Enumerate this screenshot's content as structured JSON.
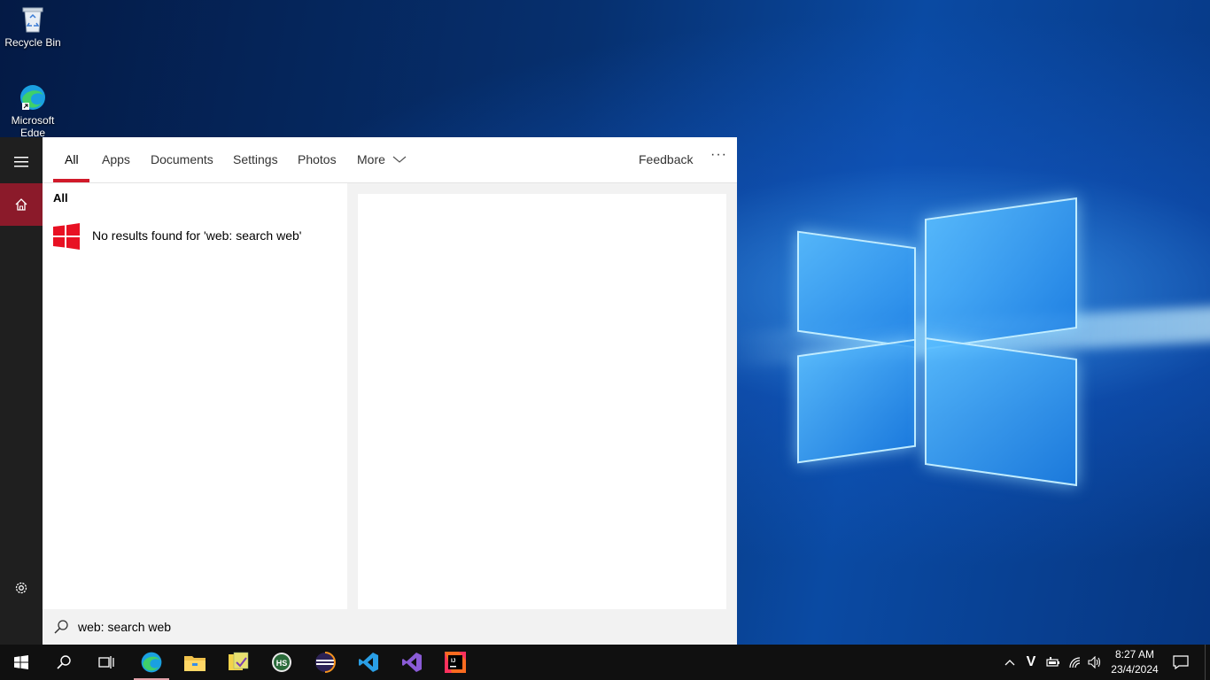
{
  "desktop": {
    "icons": [
      {
        "label": "Recycle Bin",
        "icon": "recycle-bin-icon"
      },
      {
        "label": "Microsoft Edge",
        "icon": "edge-icon"
      }
    ]
  },
  "search_panel": {
    "tabs": [
      {
        "label": "All",
        "active": true
      },
      {
        "label": "Apps"
      },
      {
        "label": "Documents"
      },
      {
        "label": "Settings"
      },
      {
        "label": "Photos"
      },
      {
        "label": "More"
      }
    ],
    "feedback_label": "Feedback",
    "more_options_glyph": "···",
    "section_header": "All",
    "no_results_text": "No results found for 'web: search web'",
    "query": "web: search web"
  },
  "taskbar": {
    "apps": [
      "start-icon",
      "search-icon",
      "task-view-icon",
      "edge-icon",
      "file-explorer-icon",
      "sticky-app-icon",
      "hs-app-icon",
      "eclipse-icon",
      "vscode-icon",
      "visual-studio-icon",
      "intellij-icon"
    ],
    "tray_letter": "V",
    "time": "8:27 AM",
    "date": "23/4/2024"
  },
  "colors": {
    "accent": "#d11a2a",
    "home_highlight": "#8b1a2a",
    "rail_bg": "#1f1f1f",
    "taskbar_bg": "#101010"
  }
}
